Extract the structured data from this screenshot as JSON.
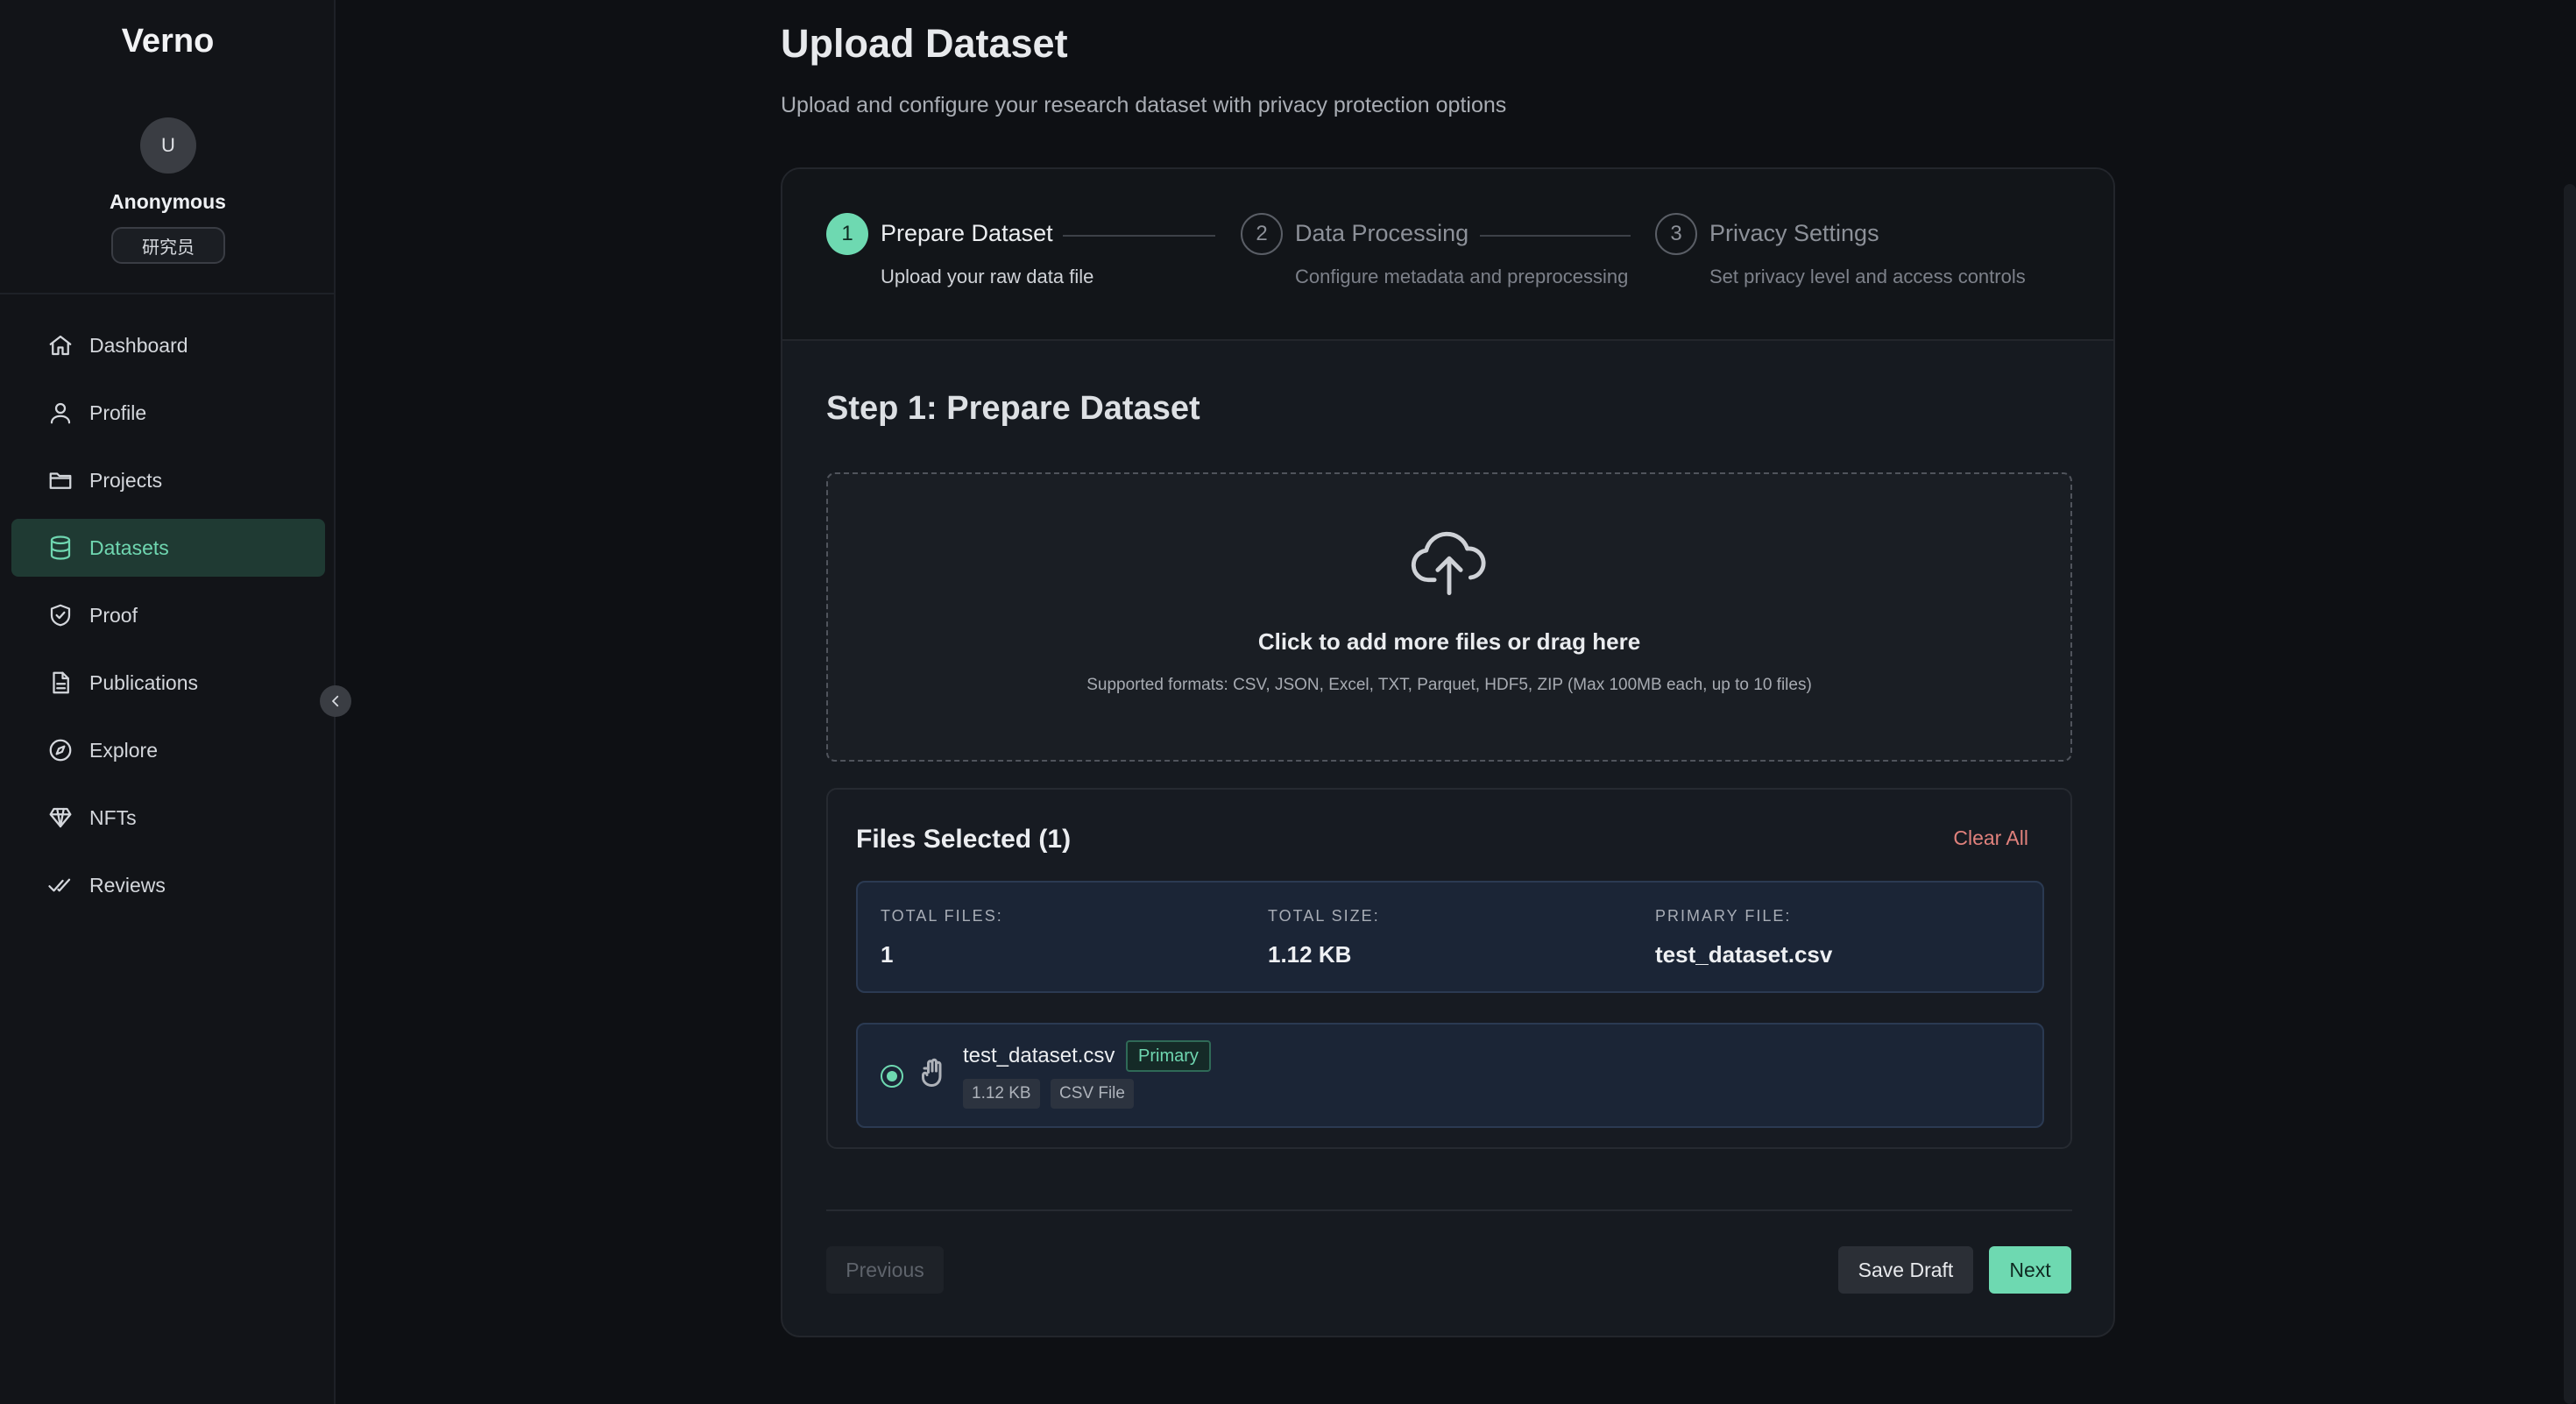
{
  "app": {
    "brand": "Verno"
  },
  "user": {
    "avatar_initial": "U",
    "name": "Anonymous",
    "role": "研究员"
  },
  "nav": [
    {
      "label": "Dashboard",
      "icon": "home-icon",
      "active": false
    },
    {
      "label": "Profile",
      "icon": "user-icon",
      "active": false
    },
    {
      "label": "Projects",
      "icon": "folder-icon",
      "active": false
    },
    {
      "label": "Datasets",
      "icon": "database-icon",
      "active": true
    },
    {
      "label": "Proof",
      "icon": "shield-check-icon",
      "active": false
    },
    {
      "label": "Publications",
      "icon": "document-icon",
      "active": false
    },
    {
      "label": "Explore",
      "icon": "compass-icon",
      "active": false
    },
    {
      "label": "NFTs",
      "icon": "diamond-icon",
      "active": false
    },
    {
      "label": "Reviews",
      "icon": "double-check-icon",
      "active": false
    }
  ],
  "page": {
    "title": "Upload Dataset",
    "subtitle": "Upload and configure your research dataset with privacy protection options"
  },
  "steps": [
    {
      "number": "1",
      "title": "Prepare Dataset",
      "description": "Upload your raw data file",
      "active": true
    },
    {
      "number": "2",
      "title": "Data Processing",
      "description": "Configure metadata and preprocessing",
      "active": false
    },
    {
      "number": "3",
      "title": "Privacy Settings",
      "description": "Set privacy level and access controls",
      "active": false
    }
  ],
  "step_heading": "Step 1: Prepare Dataset",
  "dropzone": {
    "icon": "cloud-upload-icon",
    "title": "Click to add more files or drag here",
    "subtitle": "Supported formats: CSV, JSON, Excel, TXT, Parquet, HDF5, ZIP (Max 100MB each, up to 10 files)"
  },
  "files": {
    "title": "Files Selected (1)",
    "clear_all": "Clear All",
    "summary": {
      "total_files_label": "TOTAL FILES:",
      "total_files": "1",
      "total_size_label": "TOTAL SIZE:",
      "total_size": "1.12 KB",
      "primary_file_label": "PRIMARY FILE:",
      "primary_file": "test_dataset.csv"
    },
    "items": [
      {
        "name": "test_dataset.csv",
        "badge": "Primary",
        "size": "1.12 KB",
        "type": "CSV File",
        "selected": true
      }
    ]
  },
  "actions": {
    "previous": "Previous",
    "save_draft": "Save Draft",
    "next": "Next"
  },
  "colors": {
    "accent": "#6ed9b1",
    "danger": "#e0817c",
    "background": "#0e1014"
  }
}
